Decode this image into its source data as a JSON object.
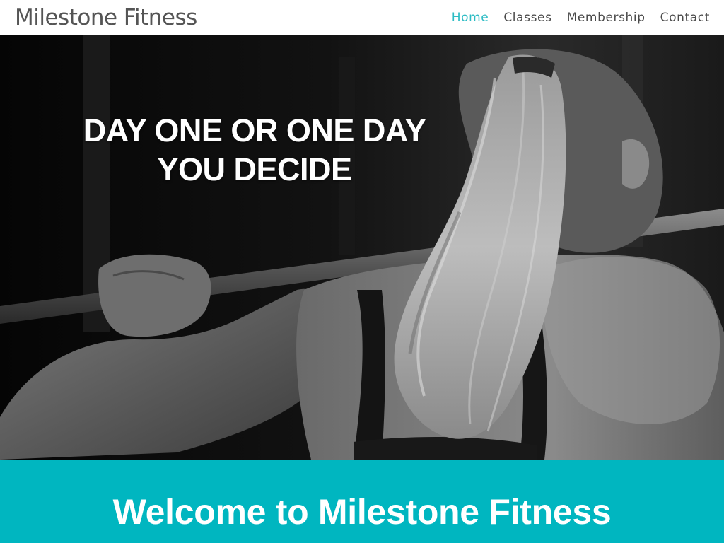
{
  "site": {
    "brand": "Milestone Fitness"
  },
  "nav": {
    "items": [
      {
        "label": "Home",
        "active": true
      },
      {
        "label": "Classes",
        "active": false
      },
      {
        "label": "Membership",
        "active": false
      },
      {
        "label": "Contact",
        "active": false
      }
    ]
  },
  "hero": {
    "heading_line1": "DAY ONE OR ONE DAY",
    "heading_line2": "YOU DECIDE",
    "image": "black-and-white photo of woman with ponytail holding a barbell on her shoulders"
  },
  "welcome": {
    "heading": "Welcome to Milestone Fitness"
  },
  "colors": {
    "accent": "#2cbcc4",
    "band": "#00b6c0",
    "nav_text": "#4a4a4a",
    "brand_text": "#555555"
  }
}
